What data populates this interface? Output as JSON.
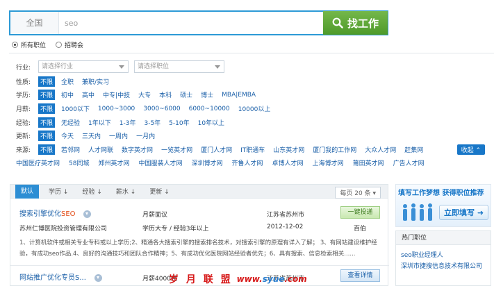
{
  "search": {
    "city": "全国",
    "keyword": "seo",
    "button_label": "找工作",
    "scopes": [
      {
        "label": "所有职位",
        "checked": true
      },
      {
        "label": "招聘会",
        "checked": false
      }
    ]
  },
  "filters": {
    "industry_label": "行业:",
    "industry_placeholder": "请选择行业",
    "position_placeholder": "请选择职位",
    "nature": {
      "label": "性质:",
      "options": [
        "不限",
        "全职",
        "兼职/实习"
      ]
    },
    "education": {
      "label": "学历:",
      "options": [
        "不限",
        "初中",
        "高中",
        "中专|中技",
        "大专",
        "本科",
        "硕士",
        "博士",
        "MBA|EMBA"
      ]
    },
    "salary": {
      "label": "月薪:",
      "options": [
        "不限",
        "1000以下",
        "1000~3000",
        "3000~6000",
        "6000~10000",
        "10000以上"
      ]
    },
    "experience": {
      "label": "经验:",
      "options": [
        "不限",
        "无经验",
        "1年以下",
        "1-3年",
        "3-5年",
        "5-10年",
        "10年以上"
      ]
    },
    "updated": {
      "label": "更新:",
      "options": [
        "不限",
        "今天",
        "三天内",
        "一周内",
        "一月内"
      ]
    },
    "source": {
      "label": "来源:",
      "options": [
        "不限",
        "若邻网",
        "人才网联",
        "数字英才网",
        "一览英才网",
        "厦门人才网",
        "IT职通车",
        "山东英才网",
        "厦门我的工作网",
        "大众人才网",
        "赶集网"
      ]
    },
    "source_more": [
      "中国医疗英才网",
      "58同城",
      "郑州英才网",
      "中国服装人才网",
      "深圳博才网",
      "齐鲁人才网",
      "卓博人才网",
      "上海博才网",
      "莆田英才网",
      "广告人才网"
    ],
    "collapse_label": "收起"
  },
  "sortbar": {
    "items": [
      "默认",
      "学历",
      "经验",
      "薪水",
      "更新"
    ],
    "per_page": "每页 20 条"
  },
  "jobs": [
    {
      "title_prefix": "搜索引擎优化",
      "title_highlight": "SEO",
      "salary": "月薪面议",
      "location": "江苏省苏州市",
      "company": "苏州仁博医院投资管理有限公司",
      "requirements": "学历大专 / 经验3年以上",
      "date": "2012-12-02",
      "source": "百伯",
      "action": "一键投递",
      "description": "1、计算机软件或相关专业专科或以上学历;2、精通各大搜索引擎的搜索排名技术，对搜索引擎的原理有详入了解； 3、有网站建设维护经验，有成功seo作品.4、良好的沟通技巧和团队合作精神；5、有成功优化医院网站经验者优先；6、具有搜索、信息检索相关......"
    },
    {
      "title_prefix": "网站推广优化专员S...",
      "title_highlight": "",
      "salary": "月薪4000元",
      "location": "江苏省苏州市",
      "action": "查看详情"
    }
  ],
  "banner": {
    "headline": "填写工作梦想  获得职位推荐",
    "cta": "立即填写"
  },
  "hot_positions": {
    "title": "热门职位",
    "items": [
      {
        "title": "seo职业经理人",
        "company": "深圳市捷搜信息技术有限公司"
      }
    ]
  },
  "watermark": {
    "brand": "岁 月 联 盟",
    "site_prefix": "www.",
    "site_mid": "syue",
    "site_suffix": ".com"
  },
  "colors": {
    "accent": "#2d9ad6",
    "selected": "#1877c8",
    "search_button": "#5ea837",
    "highlight": "#e24a14"
  }
}
